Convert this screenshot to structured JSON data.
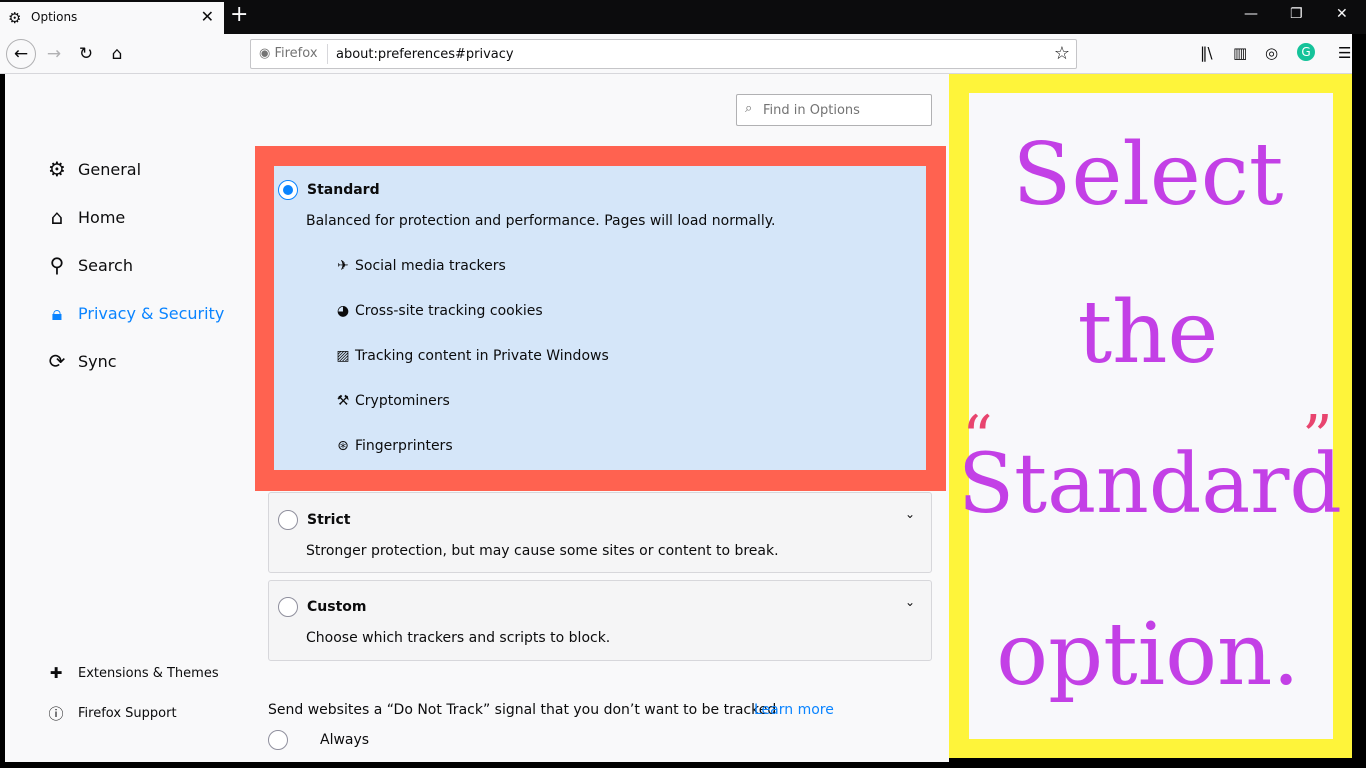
{
  "tab": {
    "title": "Options",
    "icon": "gear-icon"
  },
  "window": {
    "minimize": "—",
    "restore": "❐",
    "close": "✕"
  },
  "navbar": {
    "identity": "Firefox",
    "url": "about:preferences#privacy"
  },
  "find": {
    "placeholder": "Find in Options"
  },
  "categories": [
    {
      "label": "General",
      "icon": "gear-icon"
    },
    {
      "label": "Home",
      "icon": "home-icon"
    },
    {
      "label": "Search",
      "icon": "search-icon"
    },
    {
      "label": "Privacy & Security",
      "icon": "lock-icon",
      "active": true
    },
    {
      "label": "Sync",
      "icon": "sync-icon"
    }
  ],
  "footer": [
    {
      "label": "Extensions & Themes",
      "icon": "puzzle-icon"
    },
    {
      "label": "Firefox Support",
      "icon": "help-icon"
    }
  ],
  "options": {
    "standard": {
      "title": "Standard",
      "desc": "Balanced for protection and performance. Pages will load normally.",
      "selected": true,
      "trackers": [
        "Social media trackers",
        "Cross-site tracking cookies",
        "Tracking content in Private Windows",
        "Cryptominers",
        "Fingerprinters"
      ]
    },
    "strict": {
      "title": "Strict",
      "desc": "Stronger protection, but may cause some sites or content to break."
    },
    "custom": {
      "title": "Custom",
      "desc": "Choose which trackers and scripts to block."
    }
  },
  "dnt": {
    "text": "Send websites a “Do Not Track” signal that you don’t want to be tracked",
    "link": "Learn more",
    "always": "Always"
  },
  "annotation": {
    "line1": "Select",
    "line2": "the",
    "line3": "Standard",
    "line4": "option.",
    "open_quote": "“",
    "close_quote": "”",
    "colors": {
      "frame": "#fef43a",
      "text": "#c340e6",
      "quotes": "#e8446e"
    }
  },
  "colors": {
    "highlight": "#ff6250",
    "selected_bg": "#d5e6f9",
    "accent": "#0a84ff"
  }
}
